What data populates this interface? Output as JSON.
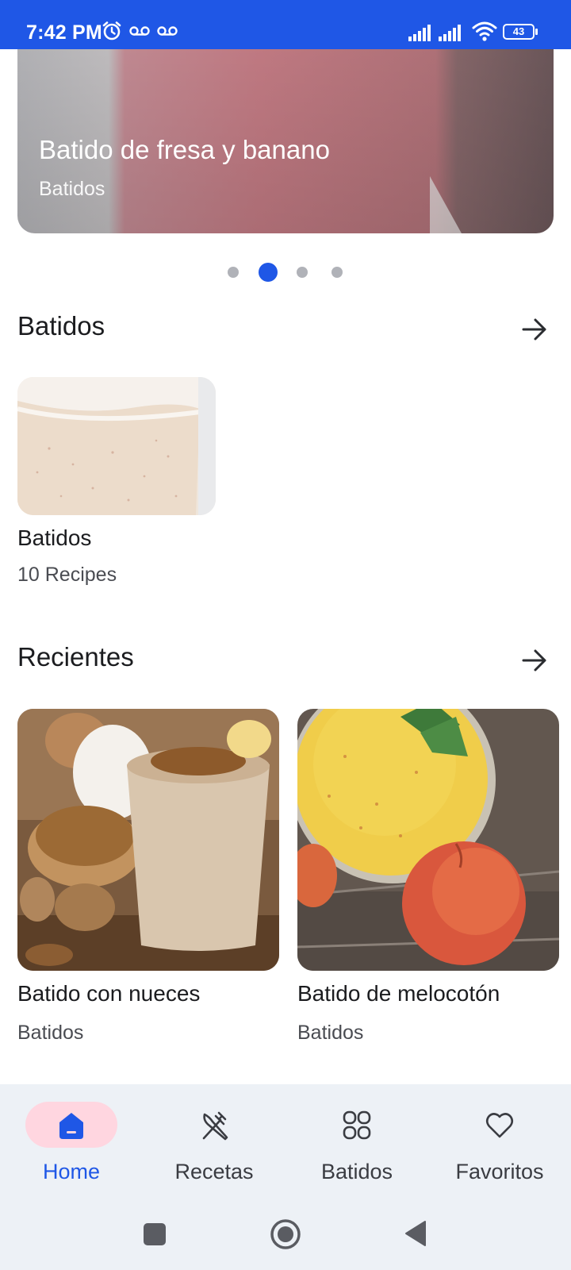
{
  "status_bar": {
    "time": "7:42 PM",
    "battery": "43",
    "icons": [
      "alarm-icon",
      "voicemail-icon",
      "voicemail-icon",
      "signal-icon",
      "signal-icon",
      "wifi-icon",
      "battery-icon"
    ]
  },
  "hero": {
    "title": "Batido de fresa y banano",
    "subtitle": "Batidos",
    "carousel_count": 4,
    "carousel_active_index": 1
  },
  "sections": {
    "categories": {
      "title": "Batidos",
      "arrow_icon": "arrow-right-icon",
      "items": [
        {
          "title": "Batidos",
          "count": "10 Recipes"
        }
      ]
    },
    "recent": {
      "title": "Recientes",
      "arrow_icon": "arrow-right-icon",
      "items": [
        {
          "title": "Batido con nueces",
          "category": "Batidos"
        },
        {
          "title": "Batido de melocotón",
          "category": "Batidos"
        }
      ]
    }
  },
  "bottom_nav": {
    "items": [
      {
        "label": "Home",
        "icon": "home-icon",
        "active": true
      },
      {
        "label": "Recetas",
        "icon": "utensils-icon",
        "active": false
      },
      {
        "label": "Batidos",
        "icon": "grid-icon",
        "active": false
      },
      {
        "label": "Favoritos",
        "icon": "heart-icon",
        "active": false
      }
    ]
  },
  "system_nav": {
    "icons": [
      "recents-square-icon",
      "home-circle-icon",
      "back-triangle-icon"
    ]
  },
  "colors": {
    "primary": "#1f57e6",
    "active_pill": "#ffd6e0",
    "nav_background": "#edf1f6"
  }
}
